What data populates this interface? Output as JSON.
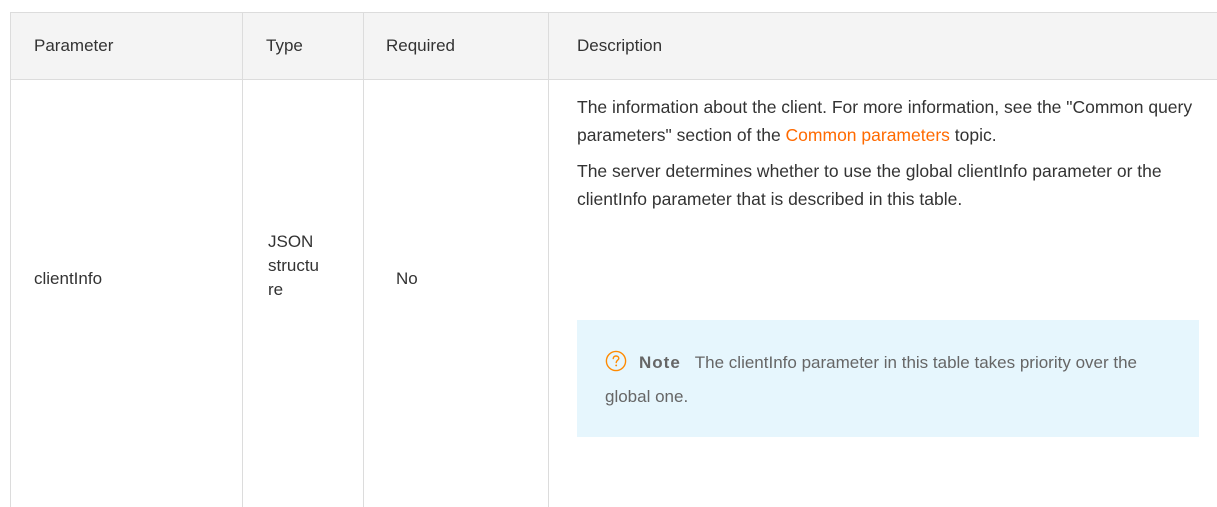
{
  "table": {
    "headers": {
      "parameter": "Parameter",
      "type": "Type",
      "required": "Required",
      "description": "Description"
    },
    "rows": [
      {
        "parameter": "clientInfo",
        "type_lines": [
          "JSON",
          "structu",
          "re"
        ],
        "required": "No",
        "description": {
          "p1_before_link": "The information about the client. For more information, see the \"Common query parameters\" section of the ",
          "p1_link": "Common parameters",
          "p1_after_link": " topic.",
          "p2": "The server determines whether to use the global clientInfo parameter or the clientInfo parameter that is described in this table.",
          "note_label": "Note",
          "note_text": "The clientInfo parameter in this table takes priority over the global one."
        }
      }
    ]
  },
  "colors": {
    "link": "#ff6a00",
    "note_background": "#e6f6fd",
    "note_icon": "#ff8a00",
    "header_background": "#f4f4f4"
  },
  "icons": {
    "note": "question-circle-icon"
  }
}
